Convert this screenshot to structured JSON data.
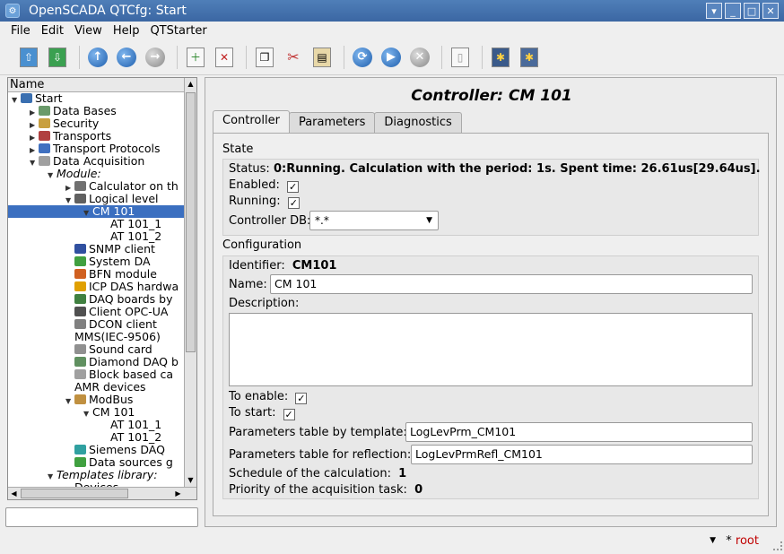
{
  "window": {
    "title": "OpenSCADA QTCfg: Start",
    "buttons": [
      "▾",
      "_",
      "□",
      "✕"
    ]
  },
  "menu": [
    "File",
    "Edit",
    "View",
    "Help",
    "QTStarter"
  ],
  "toolbar": {
    "icons": [
      "load-icon",
      "save-icon",
      "up-icon",
      "back-icon",
      "forward-icon",
      "add-icon",
      "delete-icon",
      "copy-icon",
      "cut-icon",
      "paste-icon",
      "refresh-icon",
      "start-icon",
      "stop-icon",
      "manual-icon",
      "config-icon",
      "config2-icon"
    ]
  },
  "tree": {
    "header": "Name",
    "nodes": [
      {
        "label": "Start",
        "depth": 0,
        "expander": "▼",
        "italic": false,
        "color": "#3a6fb0"
      },
      {
        "label": "Data Bases",
        "depth": 1,
        "expander": "▶",
        "italic": false,
        "color": "#6a9a6a"
      },
      {
        "label": "Security",
        "depth": 1,
        "expander": "▶",
        "italic": false,
        "color": "#c8a040"
      },
      {
        "label": "Transports",
        "depth": 1,
        "expander": "▶",
        "italic": false,
        "color": "#b04040"
      },
      {
        "label": "Transport Protocols",
        "depth": 1,
        "expander": "▶",
        "italic": false,
        "color": "#4070c0"
      },
      {
        "label": "Data Acquisition",
        "depth": 1,
        "expander": "▼",
        "italic": false,
        "color": "#a0a0a0"
      },
      {
        "label": "Module:",
        "depth": 2,
        "expander": "▼",
        "italic": true,
        "color": ""
      },
      {
        "label": "Calculator on th",
        "depth": 3,
        "expander": "▶",
        "italic": false,
        "color": "#707070"
      },
      {
        "label": "Logical level",
        "depth": 3,
        "expander": "▼",
        "italic": false,
        "color": "#606060"
      },
      {
        "label": "CM 101",
        "depth": 4,
        "expander": "▼",
        "italic": false,
        "color": "",
        "selected": true
      },
      {
        "label": "AT 101_1",
        "depth": 5,
        "expander": "",
        "italic": false,
        "color": ""
      },
      {
        "label": "AT 101_2",
        "depth": 5,
        "expander": "",
        "italic": false,
        "color": ""
      },
      {
        "label": "SNMP client",
        "depth": 3,
        "expander": "",
        "italic": false,
        "color": "#3050a0"
      },
      {
        "label": "System DA",
        "depth": 3,
        "expander": "",
        "italic": false,
        "color": "#40a040"
      },
      {
        "label": "BFN module",
        "depth": 3,
        "expander": "",
        "italic": false,
        "color": "#d06020"
      },
      {
        "label": "ICP DAS hardwa",
        "depth": 3,
        "expander": "",
        "italic": false,
        "color": "#e0a000"
      },
      {
        "label": "DAQ boards by",
        "depth": 3,
        "expander": "",
        "italic": false,
        "color": "#408040"
      },
      {
        "label": "Client OPC-UA",
        "depth": 3,
        "expander": "",
        "italic": false,
        "color": "#505050"
      },
      {
        "label": "DCON client",
        "depth": 3,
        "expander": "",
        "italic": false,
        "color": "#808080"
      },
      {
        "label": "MMS(IEC-9506)",
        "depth": 3,
        "expander": "",
        "italic": false,
        "color": "",
        "noicon": true
      },
      {
        "label": "Sound card",
        "depth": 3,
        "expander": "",
        "italic": false,
        "color": "#909090"
      },
      {
        "label": "Diamond DAQ b",
        "depth": 3,
        "expander": "",
        "italic": false,
        "color": "#609060"
      },
      {
        "label": "Block based ca",
        "depth": 3,
        "expander": "",
        "italic": false,
        "color": "#a0a0a0"
      },
      {
        "label": "AMR devices",
        "depth": 3,
        "expander": "",
        "italic": false,
        "color": "",
        "noicon": true
      },
      {
        "label": "ModBus",
        "depth": 3,
        "expander": "▼",
        "italic": false,
        "color": "#c09040"
      },
      {
        "label": "CM 101",
        "depth": 4,
        "expander": "▼",
        "italic": false,
        "color": ""
      },
      {
        "label": "AT 101_1",
        "depth": 5,
        "expander": "",
        "italic": false,
        "color": ""
      },
      {
        "label": "AT 101_2",
        "depth": 5,
        "expander": "",
        "italic": false,
        "color": ""
      },
      {
        "label": "Siemens DAQ",
        "depth": 3,
        "expander": "",
        "italic": false,
        "color": "#30a0a0"
      },
      {
        "label": "Data sources g",
        "depth": 3,
        "expander": "",
        "italic": false,
        "color": "#40a040"
      },
      {
        "label": "Templates library:",
        "depth": 2,
        "expander": "▼",
        "italic": true,
        "color": ""
      },
      {
        "label": "Devices",
        "depth": 3,
        "expander": "▶",
        "italic": false,
        "color": ""
      }
    ]
  },
  "panel": {
    "title": "Controller: CM 101",
    "tabs": [
      "Controller",
      "Parameters",
      "Diagnostics"
    ],
    "state": {
      "label": "State",
      "status_label": "Status:",
      "status_value": "0:Running. Calculation with the period: 1s. Spent time: 26.61us[29.64us].",
      "enabled_label": "Enabled:",
      "running_label": "Running:",
      "db_label": "Controller DB:",
      "db_value": "*.*"
    },
    "config": {
      "label": "Configuration",
      "identifier_label": "Identifier:",
      "identifier_value": "CM101",
      "name_label": "Name:",
      "name_value": "CM 101",
      "description_label": "Description:",
      "to_enable_label": "To enable:",
      "to_start_label": "To start:",
      "tmpl_table_label": "Parameters table by template:",
      "tmpl_table_value": "LogLevPrm_CM101",
      "refl_table_label": "Parameters table for reflection:",
      "refl_table_value": "LogLevPrmRefl_CM101",
      "schedule_label": "Schedule of the calculation:",
      "schedule_value": "1",
      "priority_label": "Priority of the acquisition task:",
      "priority_value": "0"
    }
  },
  "status": {
    "star": "*",
    "user": "root"
  }
}
